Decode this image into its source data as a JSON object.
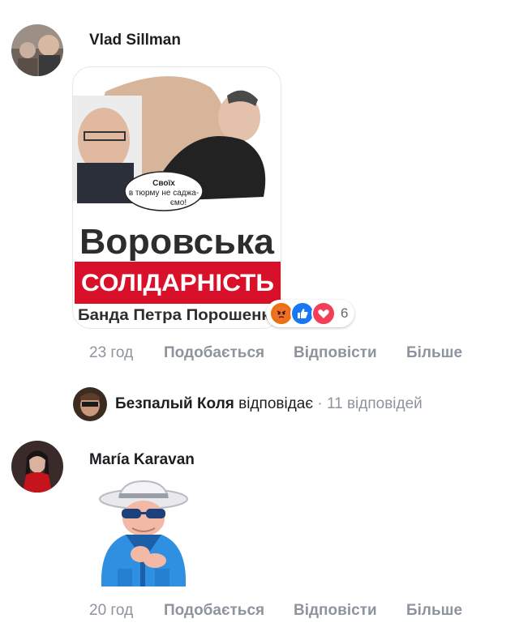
{
  "comments": [
    {
      "author": "Vlad Sillman",
      "image": {
        "bubble_text": "Своїх\nв тюрму не саджа-\nємо!",
        "line1": "Воровська",
        "line2": "СОЛІДАРНІСТЬ",
        "line3": "Банда Петра Порошенка"
      },
      "reactions": {
        "icons": [
          "angry-icon",
          "like-icon",
          "love-icon"
        ],
        "count": "6"
      },
      "time": "23 год",
      "like_label": "Подобається",
      "reply_label": "Відповісти",
      "more_label": "Більше",
      "replies": {
        "author": "Безпалый Коля",
        "verb": "відповідає",
        "separator": " · ",
        "count_label": "11 відповідей"
      }
    },
    {
      "author": "María Karavan",
      "sticker": "old-man-sunglasses-sticker",
      "time": "20 год",
      "like_label": "Подобається",
      "reply_label": "Відповісти",
      "more_label": "Більше"
    }
  ],
  "colors": {
    "red_band": "#d8102a",
    "meta": "#8d949e",
    "like_blue": "#1877f2",
    "love_red": "#f33e58",
    "angry_orange": "#e9710f"
  }
}
